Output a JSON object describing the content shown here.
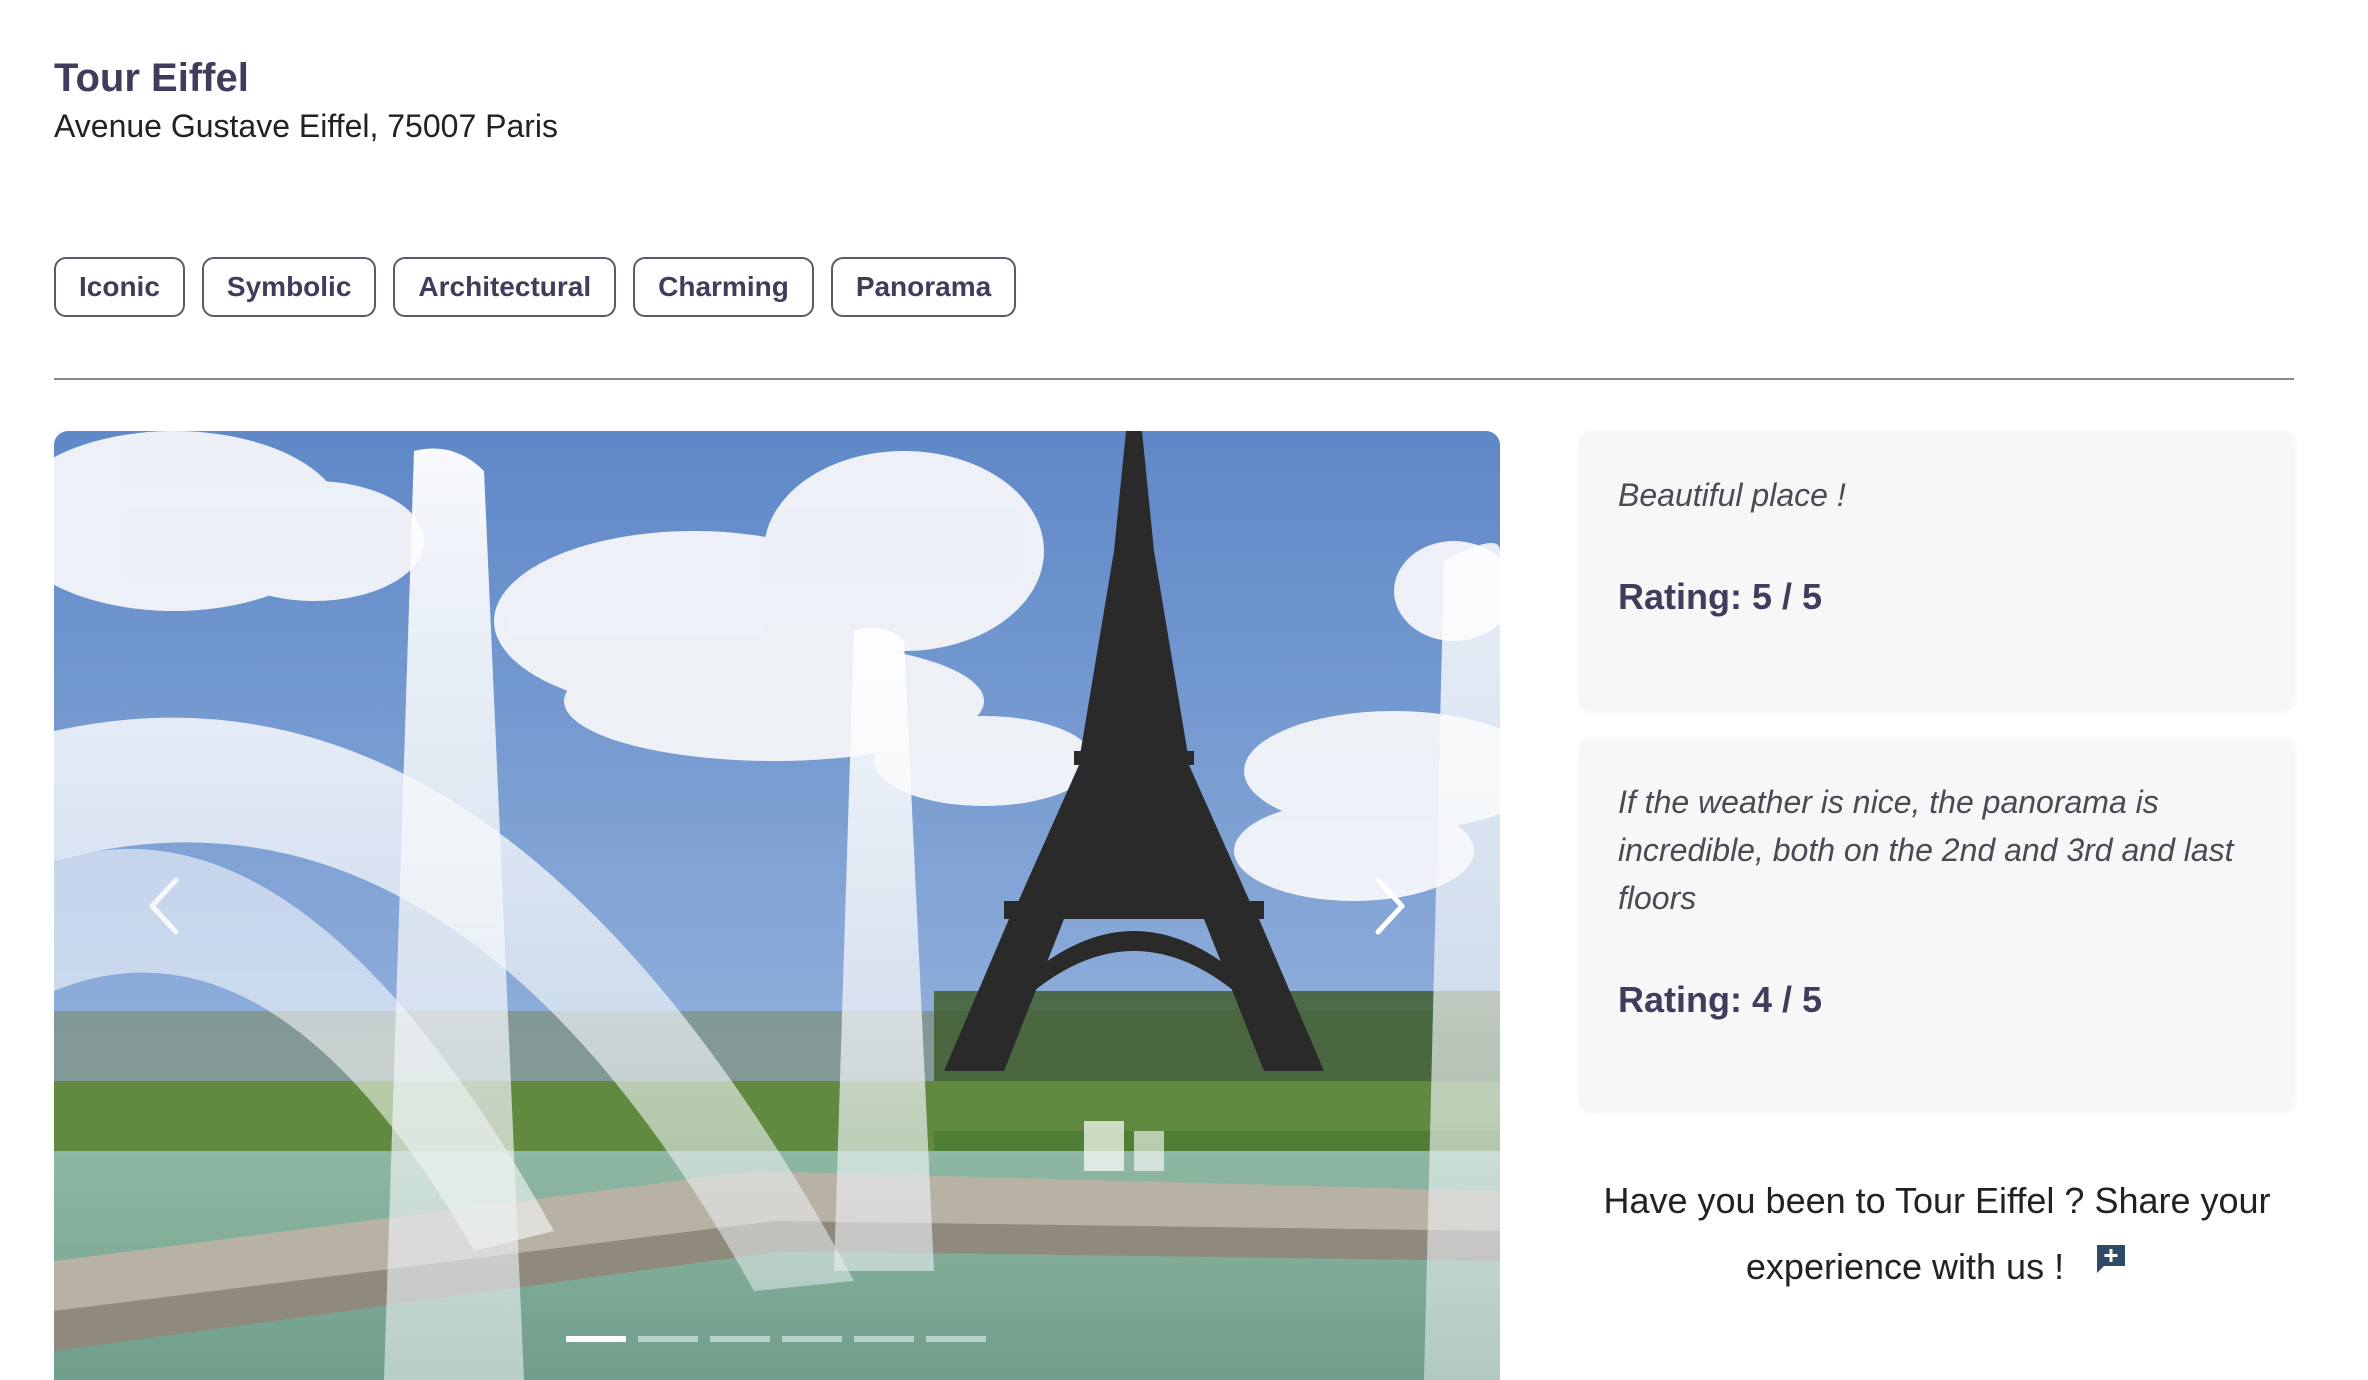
{
  "place": {
    "name": "Tour Eiffel",
    "address": "Avenue Gustave Eiffel, 75007 Paris"
  },
  "tags": [
    "Iconic",
    "Symbolic",
    "Architectural",
    "Charming",
    "Panorama"
  ],
  "carousel": {
    "slide_count": 6,
    "active_index": 0,
    "prev_icon": "chevron-left-icon",
    "next_icon": "chevron-right-icon"
  },
  "reviews": [
    {
      "text": "Beautiful place !",
      "rating": "Rating: 5 / 5"
    },
    {
      "text": "If the weather is nice, the panorama is incredible, both on the 2nd and 3rd and last floors",
      "rating": "Rating: 4 / 5"
    }
  ],
  "share": {
    "text": "Have you been to Tour Eiffel ? Share your experience with us !",
    "icon": "add-comment-icon"
  },
  "colors": {
    "title": "#3f3d5c",
    "card_bg": "#f7f7f8",
    "icon": "#2e4a66"
  }
}
